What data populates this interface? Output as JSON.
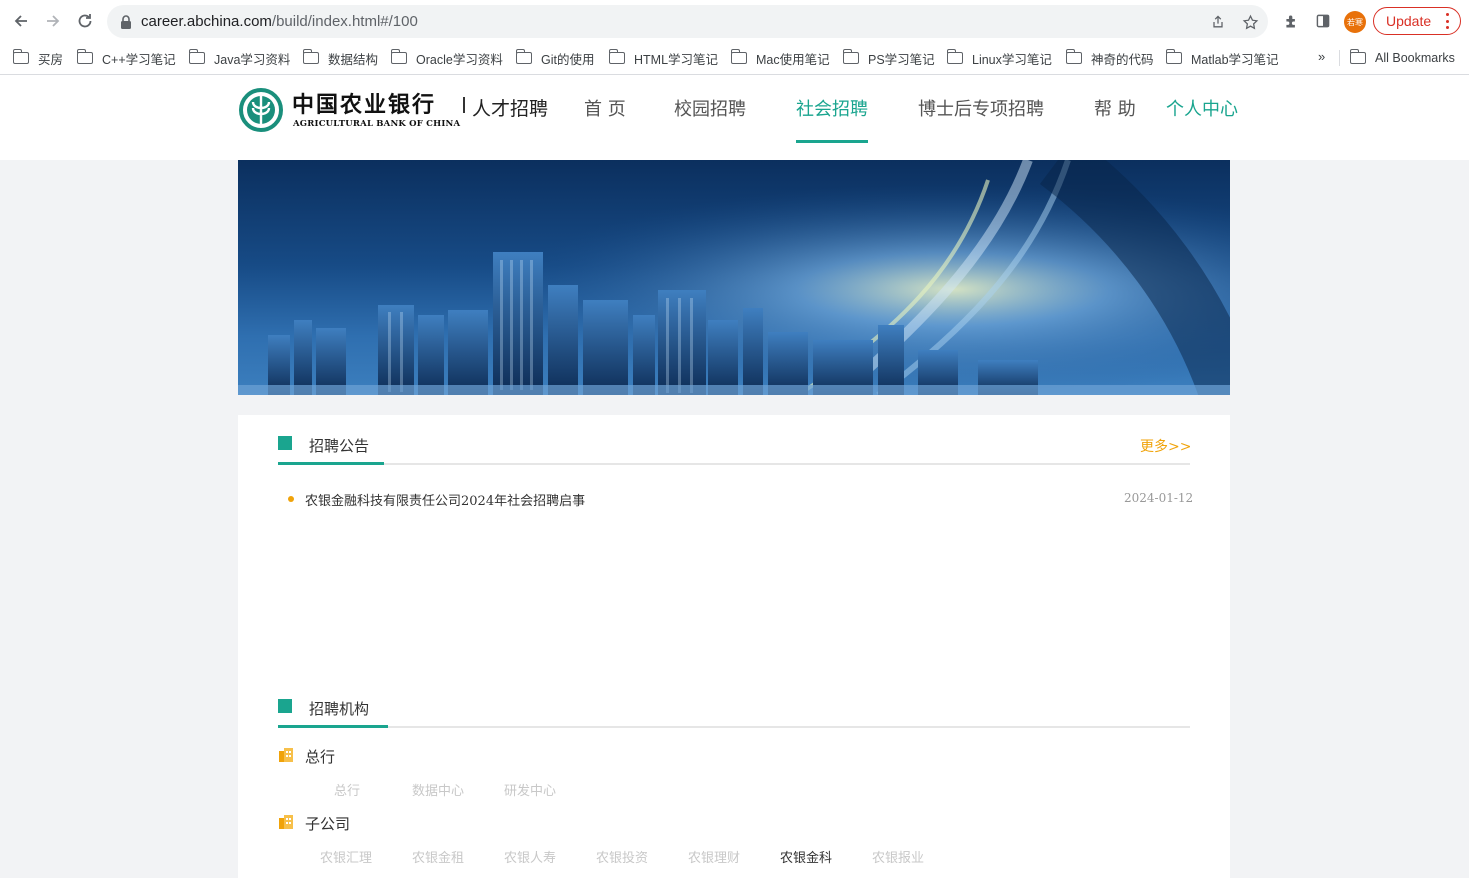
{
  "browser": {
    "url_main": "career.abchina.com",
    "url_rest": "/build/index.html#/100",
    "avatar_text": "若寒",
    "update_label": "Update",
    "bookmarks": [
      "买房",
      "C++学习笔记",
      "Java学习资料",
      "数据结构",
      "Oracle学习资料",
      "Git的使用",
      "HTML学习笔记",
      "Mac使用笔记",
      "PS学习笔记",
      "Linux学习笔记",
      "神奇的代码",
      "Matlab学习笔记"
    ],
    "bookmarks_more": "»",
    "all_bookmarks": "All Bookmarks"
  },
  "site": {
    "logo_cn": "中国农业银行",
    "logo_en": "AGRICULTURAL BANK OF CHINA",
    "logo_sub": "人才招聘",
    "menu": [
      "首 页",
      "校园招聘",
      "社会招聘",
      "博士后专项招聘",
      "帮 助"
    ],
    "personal": "个人中心",
    "brand_color": "#1aa58f"
  },
  "notices": {
    "title": "招聘公告",
    "more": "更多>>",
    "items": [
      {
        "title": "农银金融科技有限责任公司2024年社会招聘启事",
        "date": "2024-01-12"
      }
    ]
  },
  "orgs": {
    "title": "招聘机构",
    "groups": [
      {
        "name": "总行",
        "items": [
          "总行",
          "数据中心",
          "研发中心"
        ]
      },
      {
        "name": "子公司",
        "items": [
          "农银汇理",
          "农银金租",
          "农银人寿",
          "农银投资",
          "农银理财",
          "农银金科",
          "农银报业"
        ],
        "selected": "农银金科"
      }
    ]
  }
}
